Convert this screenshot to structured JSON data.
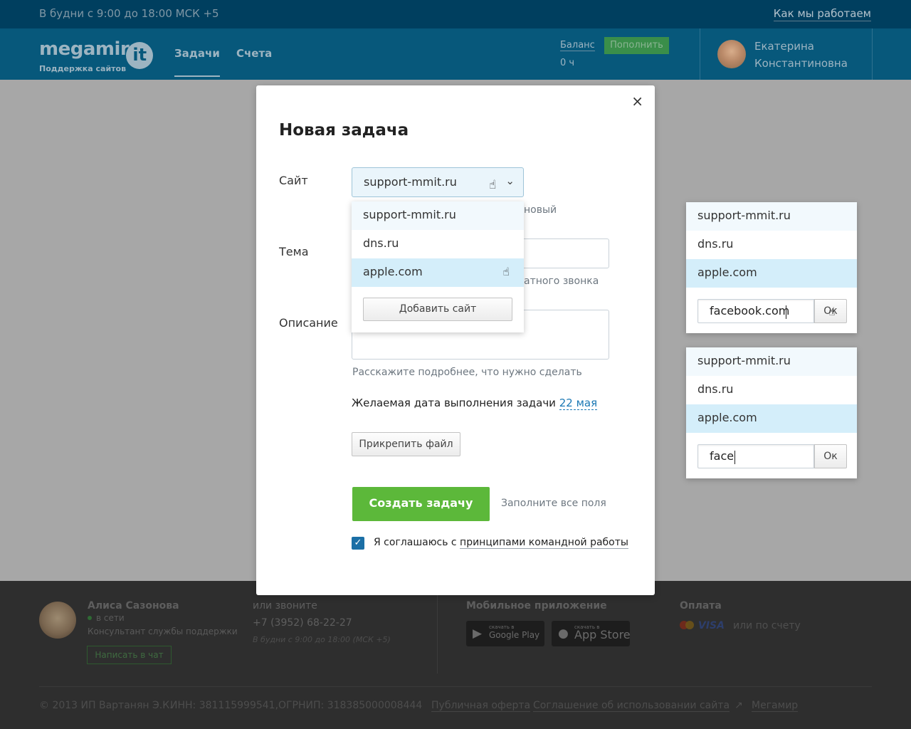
{
  "topbar": {
    "hours": "В будни с 9:00 до 18:00 МСК +5",
    "how_link": "Как мы работаем"
  },
  "header": {
    "logo_word": "megamir",
    "logo_it": "it",
    "logo_sub": "Поддержка сайтов",
    "tabs": [
      {
        "label": "Задачи",
        "active": true
      },
      {
        "label": "Счета",
        "active": false
      }
    ],
    "balance_label": "Баланс",
    "balance_value": "0 ч",
    "topup_label": "Пополнить",
    "user_first": "Екатерина",
    "user_last": "Константиновна"
  },
  "modal": {
    "close_glyph": "×",
    "title": "Новая задача",
    "site_label": "Сайт",
    "site_value": "support-mmit.ru",
    "site_helper_fragment": "новый",
    "topic_label": "Тема",
    "topic_helper_fragment": "атного звонка",
    "desc_label": "Описание",
    "desc_helper": "Расскажите подробнее, что нужно сделать",
    "date_prefix": "Желаемая дата выполнения задачи",
    "date_value": "22 мая",
    "attach_label": "Прикрепить файл",
    "create_label": "Создать задачу",
    "fill_all": "Заполните все поля",
    "agree_prefix": "Я соглашаюсь с",
    "agree_link": "принципами командной работы",
    "agree_checked": true
  },
  "dropdown": {
    "items": [
      "support-mmit.ru",
      "dns.ru",
      "apple.com"
    ],
    "add_label": "Добавить сайт",
    "hover_index": 2
  },
  "panel1": {
    "items": [
      "support-mmit.ru",
      "dns.ru",
      "apple.com"
    ],
    "input_value": "facebook.com",
    "ok_label": "Ок"
  },
  "panel2": {
    "items": [
      "support-mmit.ru",
      "dns.ru",
      "apple.com"
    ],
    "input_value": "face",
    "ok_label": "Ок"
  },
  "footer": {
    "agent_name": "Алиса Сазонова",
    "agent_status": "в сети",
    "agent_role": "Консультант службы поддержки",
    "chat_label": "Написать в чат",
    "call_title": "или звоните",
    "phone": "+7 (3952) 68-22-27",
    "call_hours": "В будни с 9:00 до 18:00 (МСК +5)",
    "mobile_title": "Мобильное приложение",
    "google_small": "скачать в",
    "google_big": "Google Play",
    "apple_small": "скачать в",
    "apple_big": "App Store",
    "payment_title": "Оплата",
    "visa": "VISA",
    "payment_invoice": "или по счету",
    "copyright": "© 2013 ИП Вартанян Э.К.",
    "inn": "ИНН: 381115999541,",
    "ogrnip": "ОГРНИП: 318385000008444",
    "offer": "Публичная оферта",
    "agreement": "Соглашение об использовании сайта",
    "megamir": "Мегамир"
  },
  "colors": {
    "header_bg": "#07587b",
    "topbar_bg": "#003f5f",
    "accent_green": "#5cb83a",
    "link_blue": "#1a78b4",
    "hover_blue": "#d4eefa"
  }
}
